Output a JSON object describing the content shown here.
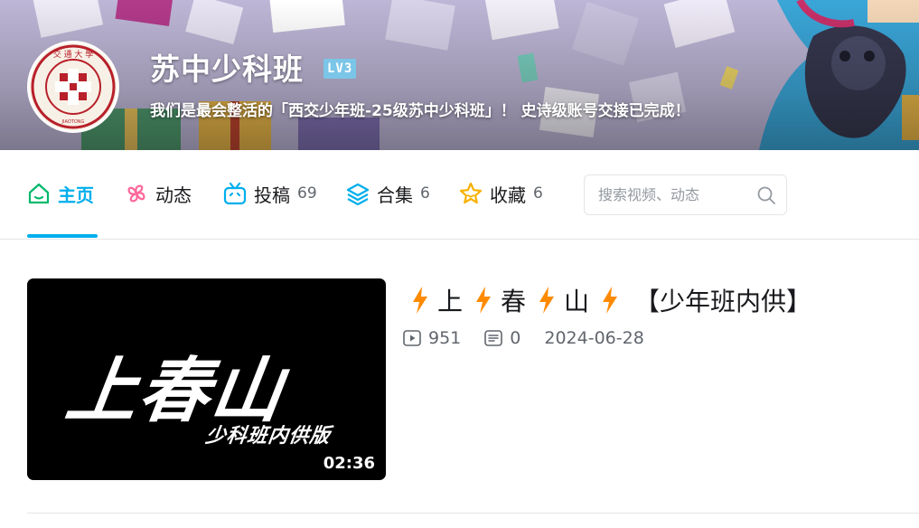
{
  "profile": {
    "username": "苏中少科班",
    "level": "LV3",
    "bio": "我们是最会整活的「西交少年班-25级苏中少科班」！ 史诗级账号交接已完成！",
    "avatar_text": "XI'AN JIAOTONG UNIVERSITY"
  },
  "nav": {
    "items": [
      {
        "label": "主页",
        "count": "",
        "icon": "home-icon"
      },
      {
        "label": "动态",
        "count": "",
        "icon": "dynamic-icon"
      },
      {
        "label": "投稿",
        "count": "69",
        "icon": "tv-icon"
      },
      {
        "label": "合集",
        "count": "6",
        "icon": "layers-icon"
      },
      {
        "label": "收藏",
        "count": "6",
        "icon": "star-icon"
      }
    ],
    "search_placeholder": "搜索视频、动态"
  },
  "video": {
    "title_parts": [
      "上",
      "春",
      "山",
      "【少年班内供】"
    ],
    "views": "951",
    "comments": "0",
    "date": "2024-06-28",
    "duration": "02:36",
    "thumb_title": "上春山",
    "thumb_subtitle": "少科班内供版"
  },
  "colors": {
    "accent": "#00aeec",
    "home_icon": "#00b96b",
    "dynamic_icon": "#ff6699",
    "tv_icon": "#00aeec",
    "layers_icon": "#00aeec",
    "star_icon": "#f8b100",
    "bolt": "#ff8a00"
  }
}
